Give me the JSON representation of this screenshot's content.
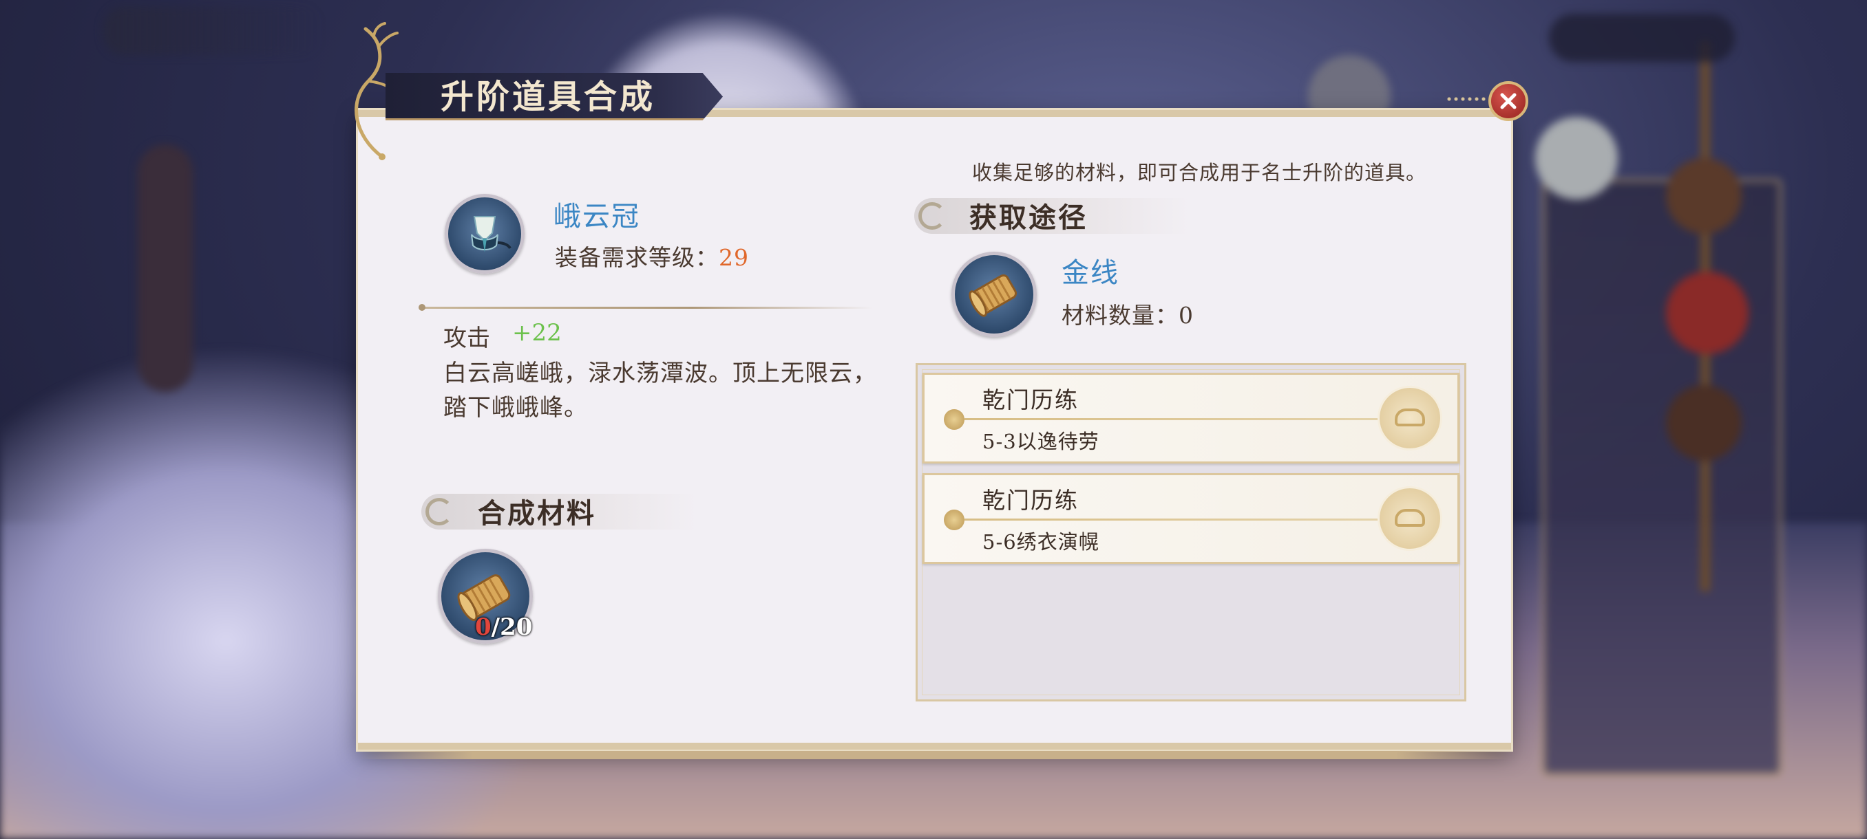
{
  "dialog": {
    "title": "升阶道具合成",
    "hint": "收集足够的材料，即可合成用于名士升阶的道具。"
  },
  "item": {
    "name": "峨云冠",
    "level_label": "装备需求等级：",
    "level_value": "29",
    "stat_label": "攻击",
    "stat_value": "+22",
    "description": "白云高嵯峨，渌水荡潭波。顶上无限云，踏下峨峨峰。",
    "icon": "crown-icon"
  },
  "synthesis": {
    "header": "合成材料",
    "material_icon": "thread-spool-icon",
    "have": "0",
    "need": "/20"
  },
  "acquire": {
    "header": "获取途径",
    "material_name": "金线",
    "count_label": "材料数量：",
    "count_value": "0",
    "sources": [
      {
        "name": "乾门历练",
        "stage": "5-3以逸待劳"
      },
      {
        "name": "乾门历练",
        "stage": "5-6绣衣演幌"
      }
    ]
  },
  "colors": {
    "item_name": "#3b86c4",
    "level_value": "#e0672a",
    "stat_value": "#6cc14c",
    "close_button": "#b83a34"
  }
}
